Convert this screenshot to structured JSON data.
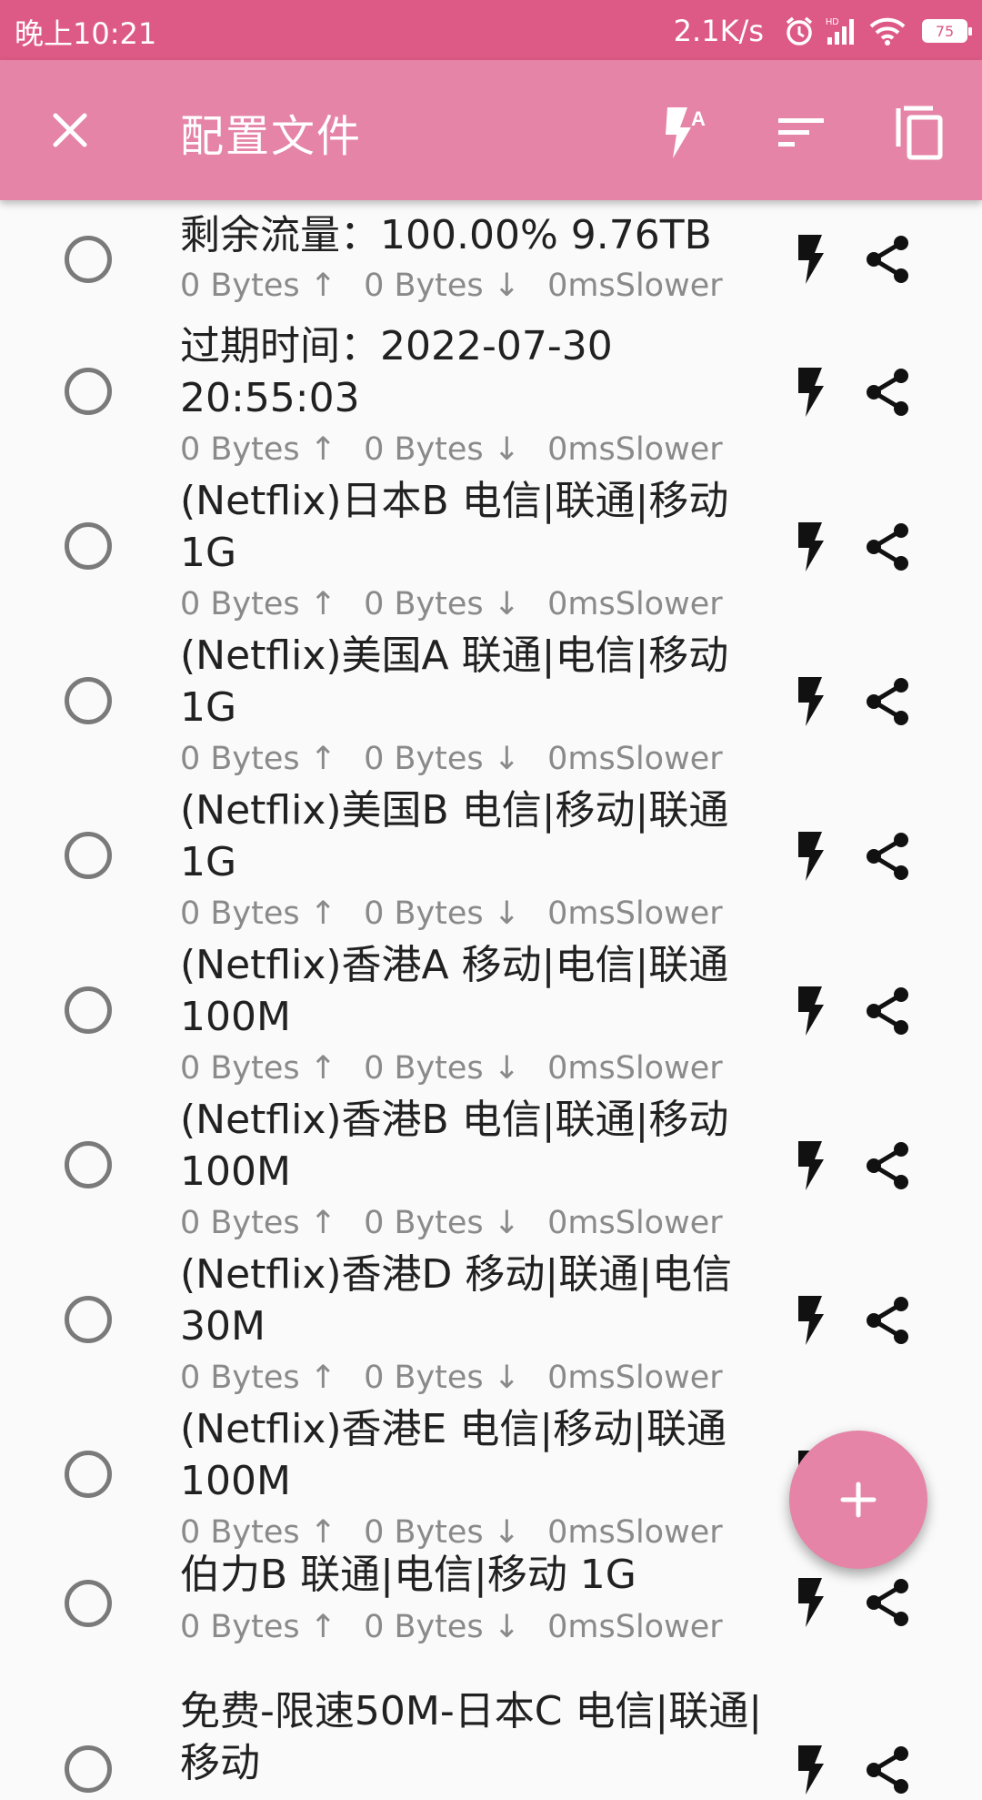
{
  "status_bar": {
    "time": "晚上10:21",
    "speed": "2.1K/s",
    "icons": [
      "alarm-icon",
      "signal-hd-icon",
      "wifi-icon",
      "battery-icon"
    ],
    "battery": "75"
  },
  "toolbar": {
    "title": "配置文件",
    "close_icon": "close-icon",
    "actions": [
      "test-all-icon",
      "sort-icon",
      "copy-icon"
    ]
  },
  "profiles": [
    {
      "name": "剩余流量：100.00% 9.76TB",
      "up": "0 Bytes ↑",
      "down": "0 Bytes ↓",
      "latency": "0ms",
      "speed": "Slower"
    },
    {
      "name": "过期时间：2022-07-30 20:55:03",
      "up": "0 Bytes ↑",
      "down": "0 Bytes ↓",
      "latency": "0ms",
      "speed": "Slower"
    },
    {
      "name": "(Netflix)日本B 电信|联通|移动 1G",
      "up": "0 Bytes ↑",
      "down": "0 Bytes ↓",
      "latency": "0ms",
      "speed": "Slower"
    },
    {
      "name": "(Netflix)美国A 联通|电信|移动 1G",
      "up": "0 Bytes ↑",
      "down": "0 Bytes ↓",
      "latency": "0ms",
      "speed": "Slower"
    },
    {
      "name": "(Netflix)美国B 电信|移动|联通 1G",
      "up": "0 Bytes ↑",
      "down": "0 Bytes ↓",
      "latency": "0ms",
      "speed": "Slower"
    },
    {
      "name": "(Netflix)香港A 移动|电信|联通 100M",
      "up": "0 Bytes ↑",
      "down": "0 Bytes ↓",
      "latency": "0ms",
      "speed": "Slower"
    },
    {
      "name": "(Netflix)香港B 电信|联通|移动 100M",
      "up": "0 Bytes ↑",
      "down": "0 Bytes ↓",
      "latency": "0ms",
      "speed": "Slower"
    },
    {
      "name": "(Netflix)香港D 移动|联通|电信 30M",
      "up": "0 Bytes ↑",
      "down": "0 Bytes ↓",
      "latency": "0ms",
      "speed": "Slower"
    },
    {
      "name": "(Netflix)香港E 电信|移动|联通 100M",
      "up": "0 Bytes ↑",
      "down": "0 Bytes ↓",
      "latency": "0ms",
      "speed": "Slower"
    },
    {
      "name": "伯力B 联通|电信|移动 1G",
      "up": "0 Bytes ↑",
      "down": "0 Bytes ↓",
      "latency": "0ms",
      "speed": "Slower"
    },
    {
      "name": "免费-限速50M-日本C 电信|联通|移动",
      "up": "",
      "down": "",
      "latency": "",
      "speed": ""
    }
  ],
  "fab": {
    "label": "+"
  },
  "colors": {
    "status_bar": "#de5a86",
    "toolbar": "#e584a6",
    "accent": "#e584a6"
  }
}
